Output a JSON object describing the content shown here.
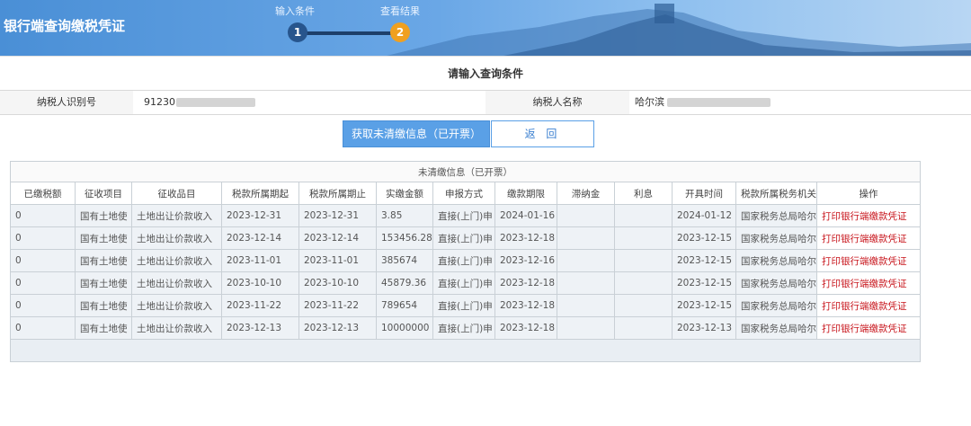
{
  "header": {
    "title": "银行端查询缴税凭证",
    "steps": [
      {
        "label": "输入条件",
        "number": "1"
      },
      {
        "label": "查看结果",
        "number": "2"
      }
    ]
  },
  "query": {
    "title": "请输入查询条件",
    "taxpayer_id_label": "纳税人识别号",
    "taxpayer_id_value": "91230",
    "taxpayer_name_label": "纳税人名称",
    "taxpayer_name_value": "哈尔滨"
  },
  "buttons": {
    "fetch_label": "获取未清缴信息（已开票）",
    "back_label": "返 回"
  },
  "table": {
    "caption": "未清缴信息（已开票）",
    "headers": [
      "已缴税额",
      "征收项目",
      "征收品目",
      "税款所属期起",
      "税款所属期止",
      "实缴金额",
      "申报方式",
      "缴款期限",
      "滞纳金",
      "利息",
      "开具时间",
      "税款所属税务机关",
      "操作"
    ],
    "rows": [
      [
        "0",
        "国有土地使",
        "土地出让价款收入",
        "2023-12-31",
        "2023-12-31",
        "3.85",
        "直接(上门)申",
        "2024-01-16",
        "",
        "",
        "2024-01-12",
        "国家税务总局哈尔",
        "打印银行端缴款凭证"
      ],
      [
        "0",
        "国有土地使",
        "土地出让价款收入",
        "2023-12-14",
        "2023-12-14",
        "153456.28",
        "直接(上门)申",
        "2023-12-18",
        "",
        "",
        "2023-12-15",
        "国家税务总局哈尔",
        "打印银行端缴款凭证"
      ],
      [
        "0",
        "国有土地使",
        "土地出让价款收入",
        "2023-11-01",
        "2023-11-01",
        "385674",
        "直接(上门)申",
        "2023-12-16",
        "",
        "",
        "2023-12-15",
        "国家税务总局哈尔",
        "打印银行端缴款凭证"
      ],
      [
        "0",
        "国有土地使",
        "土地出让价款收入",
        "2023-10-10",
        "2023-10-10",
        "45879.36",
        "直接(上门)申",
        "2023-12-18",
        "",
        "",
        "2023-12-15",
        "国家税务总局哈尔",
        "打印银行端缴款凭证"
      ],
      [
        "0",
        "国有土地使",
        "土地出让价款收入",
        "2023-11-22",
        "2023-11-22",
        "789654",
        "直接(上门)申",
        "2023-12-18",
        "",
        "",
        "2023-12-15",
        "国家税务总局哈尔",
        "打印银行端缴款凭证"
      ],
      [
        "0",
        "国有土地使",
        "土地出让价款收入",
        "2023-12-13",
        "2023-12-13",
        "10000000",
        "直接(上门)申",
        "2023-12-18",
        "",
        "",
        "2023-12-13",
        "国家税务总局哈尔",
        "打印银行端缴款凭证"
      ]
    ]
  }
}
